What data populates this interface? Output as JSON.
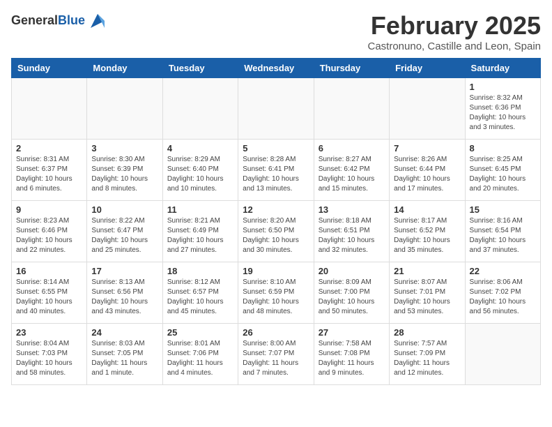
{
  "header": {
    "logo_general": "General",
    "logo_blue": "Blue",
    "month_year": "February 2025",
    "location": "Castronuno, Castille and Leon, Spain"
  },
  "days_of_week": [
    "Sunday",
    "Monday",
    "Tuesday",
    "Wednesday",
    "Thursday",
    "Friday",
    "Saturday"
  ],
  "weeks": [
    [
      {
        "num": "",
        "info": ""
      },
      {
        "num": "",
        "info": ""
      },
      {
        "num": "",
        "info": ""
      },
      {
        "num": "",
        "info": ""
      },
      {
        "num": "",
        "info": ""
      },
      {
        "num": "",
        "info": ""
      },
      {
        "num": "1",
        "info": "Sunrise: 8:32 AM\nSunset: 6:36 PM\nDaylight: 10 hours and 3 minutes."
      }
    ],
    [
      {
        "num": "2",
        "info": "Sunrise: 8:31 AM\nSunset: 6:37 PM\nDaylight: 10 hours and 6 minutes."
      },
      {
        "num": "3",
        "info": "Sunrise: 8:30 AM\nSunset: 6:39 PM\nDaylight: 10 hours and 8 minutes."
      },
      {
        "num": "4",
        "info": "Sunrise: 8:29 AM\nSunset: 6:40 PM\nDaylight: 10 hours and 10 minutes."
      },
      {
        "num": "5",
        "info": "Sunrise: 8:28 AM\nSunset: 6:41 PM\nDaylight: 10 hours and 13 minutes."
      },
      {
        "num": "6",
        "info": "Sunrise: 8:27 AM\nSunset: 6:42 PM\nDaylight: 10 hours and 15 minutes."
      },
      {
        "num": "7",
        "info": "Sunrise: 8:26 AM\nSunset: 6:44 PM\nDaylight: 10 hours and 17 minutes."
      },
      {
        "num": "8",
        "info": "Sunrise: 8:25 AM\nSunset: 6:45 PM\nDaylight: 10 hours and 20 minutes."
      }
    ],
    [
      {
        "num": "9",
        "info": "Sunrise: 8:23 AM\nSunset: 6:46 PM\nDaylight: 10 hours and 22 minutes."
      },
      {
        "num": "10",
        "info": "Sunrise: 8:22 AM\nSunset: 6:47 PM\nDaylight: 10 hours and 25 minutes."
      },
      {
        "num": "11",
        "info": "Sunrise: 8:21 AM\nSunset: 6:49 PM\nDaylight: 10 hours and 27 minutes."
      },
      {
        "num": "12",
        "info": "Sunrise: 8:20 AM\nSunset: 6:50 PM\nDaylight: 10 hours and 30 minutes."
      },
      {
        "num": "13",
        "info": "Sunrise: 8:18 AM\nSunset: 6:51 PM\nDaylight: 10 hours and 32 minutes."
      },
      {
        "num": "14",
        "info": "Sunrise: 8:17 AM\nSunset: 6:52 PM\nDaylight: 10 hours and 35 minutes."
      },
      {
        "num": "15",
        "info": "Sunrise: 8:16 AM\nSunset: 6:54 PM\nDaylight: 10 hours and 37 minutes."
      }
    ],
    [
      {
        "num": "16",
        "info": "Sunrise: 8:14 AM\nSunset: 6:55 PM\nDaylight: 10 hours and 40 minutes."
      },
      {
        "num": "17",
        "info": "Sunrise: 8:13 AM\nSunset: 6:56 PM\nDaylight: 10 hours and 43 minutes."
      },
      {
        "num": "18",
        "info": "Sunrise: 8:12 AM\nSunset: 6:57 PM\nDaylight: 10 hours and 45 minutes."
      },
      {
        "num": "19",
        "info": "Sunrise: 8:10 AM\nSunset: 6:59 PM\nDaylight: 10 hours and 48 minutes."
      },
      {
        "num": "20",
        "info": "Sunrise: 8:09 AM\nSunset: 7:00 PM\nDaylight: 10 hours and 50 minutes."
      },
      {
        "num": "21",
        "info": "Sunrise: 8:07 AM\nSunset: 7:01 PM\nDaylight: 10 hours and 53 minutes."
      },
      {
        "num": "22",
        "info": "Sunrise: 8:06 AM\nSunset: 7:02 PM\nDaylight: 10 hours and 56 minutes."
      }
    ],
    [
      {
        "num": "23",
        "info": "Sunrise: 8:04 AM\nSunset: 7:03 PM\nDaylight: 10 hours and 58 minutes."
      },
      {
        "num": "24",
        "info": "Sunrise: 8:03 AM\nSunset: 7:05 PM\nDaylight: 11 hours and 1 minute."
      },
      {
        "num": "25",
        "info": "Sunrise: 8:01 AM\nSunset: 7:06 PM\nDaylight: 11 hours and 4 minutes."
      },
      {
        "num": "26",
        "info": "Sunrise: 8:00 AM\nSunset: 7:07 PM\nDaylight: 11 hours and 7 minutes."
      },
      {
        "num": "27",
        "info": "Sunrise: 7:58 AM\nSunset: 7:08 PM\nDaylight: 11 hours and 9 minutes."
      },
      {
        "num": "28",
        "info": "Sunrise: 7:57 AM\nSunset: 7:09 PM\nDaylight: 11 hours and 12 minutes."
      },
      {
        "num": "",
        "info": ""
      }
    ]
  ]
}
